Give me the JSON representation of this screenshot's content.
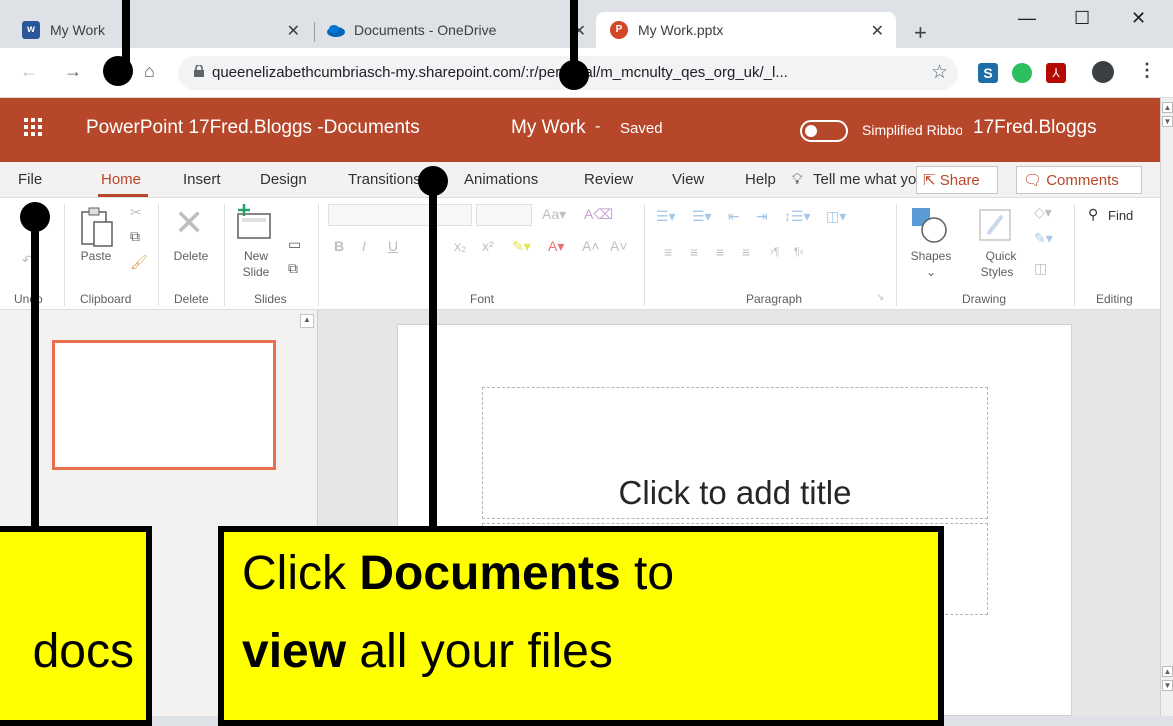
{
  "browser": {
    "tabs": [
      {
        "title": "My Work",
        "favicon": "word-icon"
      },
      {
        "title": "Documents - OneDrive",
        "favicon": "onedrive-icon"
      },
      {
        "title": "My Work.pptx",
        "favicon": "powerpoint-icon"
      }
    ],
    "new_tab": "+",
    "url": "queenelizabethcumbriasch-my.sharepoint.com/:r/personal/m_mcnulty_qes_org_uk/_l...",
    "window": {
      "minimize": "—",
      "maximize": "☐",
      "close": "✕"
    }
  },
  "office": {
    "app_title": "PowerPoint 17Fred.Bloggs -Documents",
    "doc_title": "My Work",
    "doc_separator": "-",
    "doc_status": "Saved",
    "simplified_ribbon_label": "Simplified Ribbon",
    "user_name": "17Fred.Bloggs"
  },
  "ribbon_tabs": {
    "file": "File",
    "home": "Home",
    "insert": "Insert",
    "design": "Design",
    "transitions": "Transitions",
    "animations": "Animations",
    "review": "Review",
    "view": "View",
    "help": "Help",
    "tell_me": "Tell me what you want to do",
    "share": "Share",
    "comments": "Comments"
  },
  "ribbon": {
    "groups": {
      "undo": "Undo",
      "clipboard": "Clipboard",
      "delete": "Delete",
      "slides": "Slides",
      "font": "Font",
      "paragraph": "Paragraph",
      "drawing": "Drawing",
      "editing": "Editing"
    },
    "buttons": {
      "paste": "Paste",
      "delete": "Delete",
      "new_slide_1": "New",
      "new_slide_2": "Slide",
      "shapes": "Shapes",
      "quick_styles_1": "Quick",
      "quick_styles_2": "Styles",
      "find": "Find"
    }
  },
  "slide": {
    "title_placeholder": "Click to add title"
  },
  "callouts": {
    "documents_l1_pre": "Click ",
    "documents_l1_bold": "Documents",
    "documents_l1_post": " to",
    "documents_l2_bold": "view",
    "documents_l2_post": " all your files",
    "left_l2": "docs"
  },
  "colors": {
    "office_accent": "#b7472a",
    "callout_fill": "#ffff00",
    "thumbnail_border": "#e8704e"
  }
}
